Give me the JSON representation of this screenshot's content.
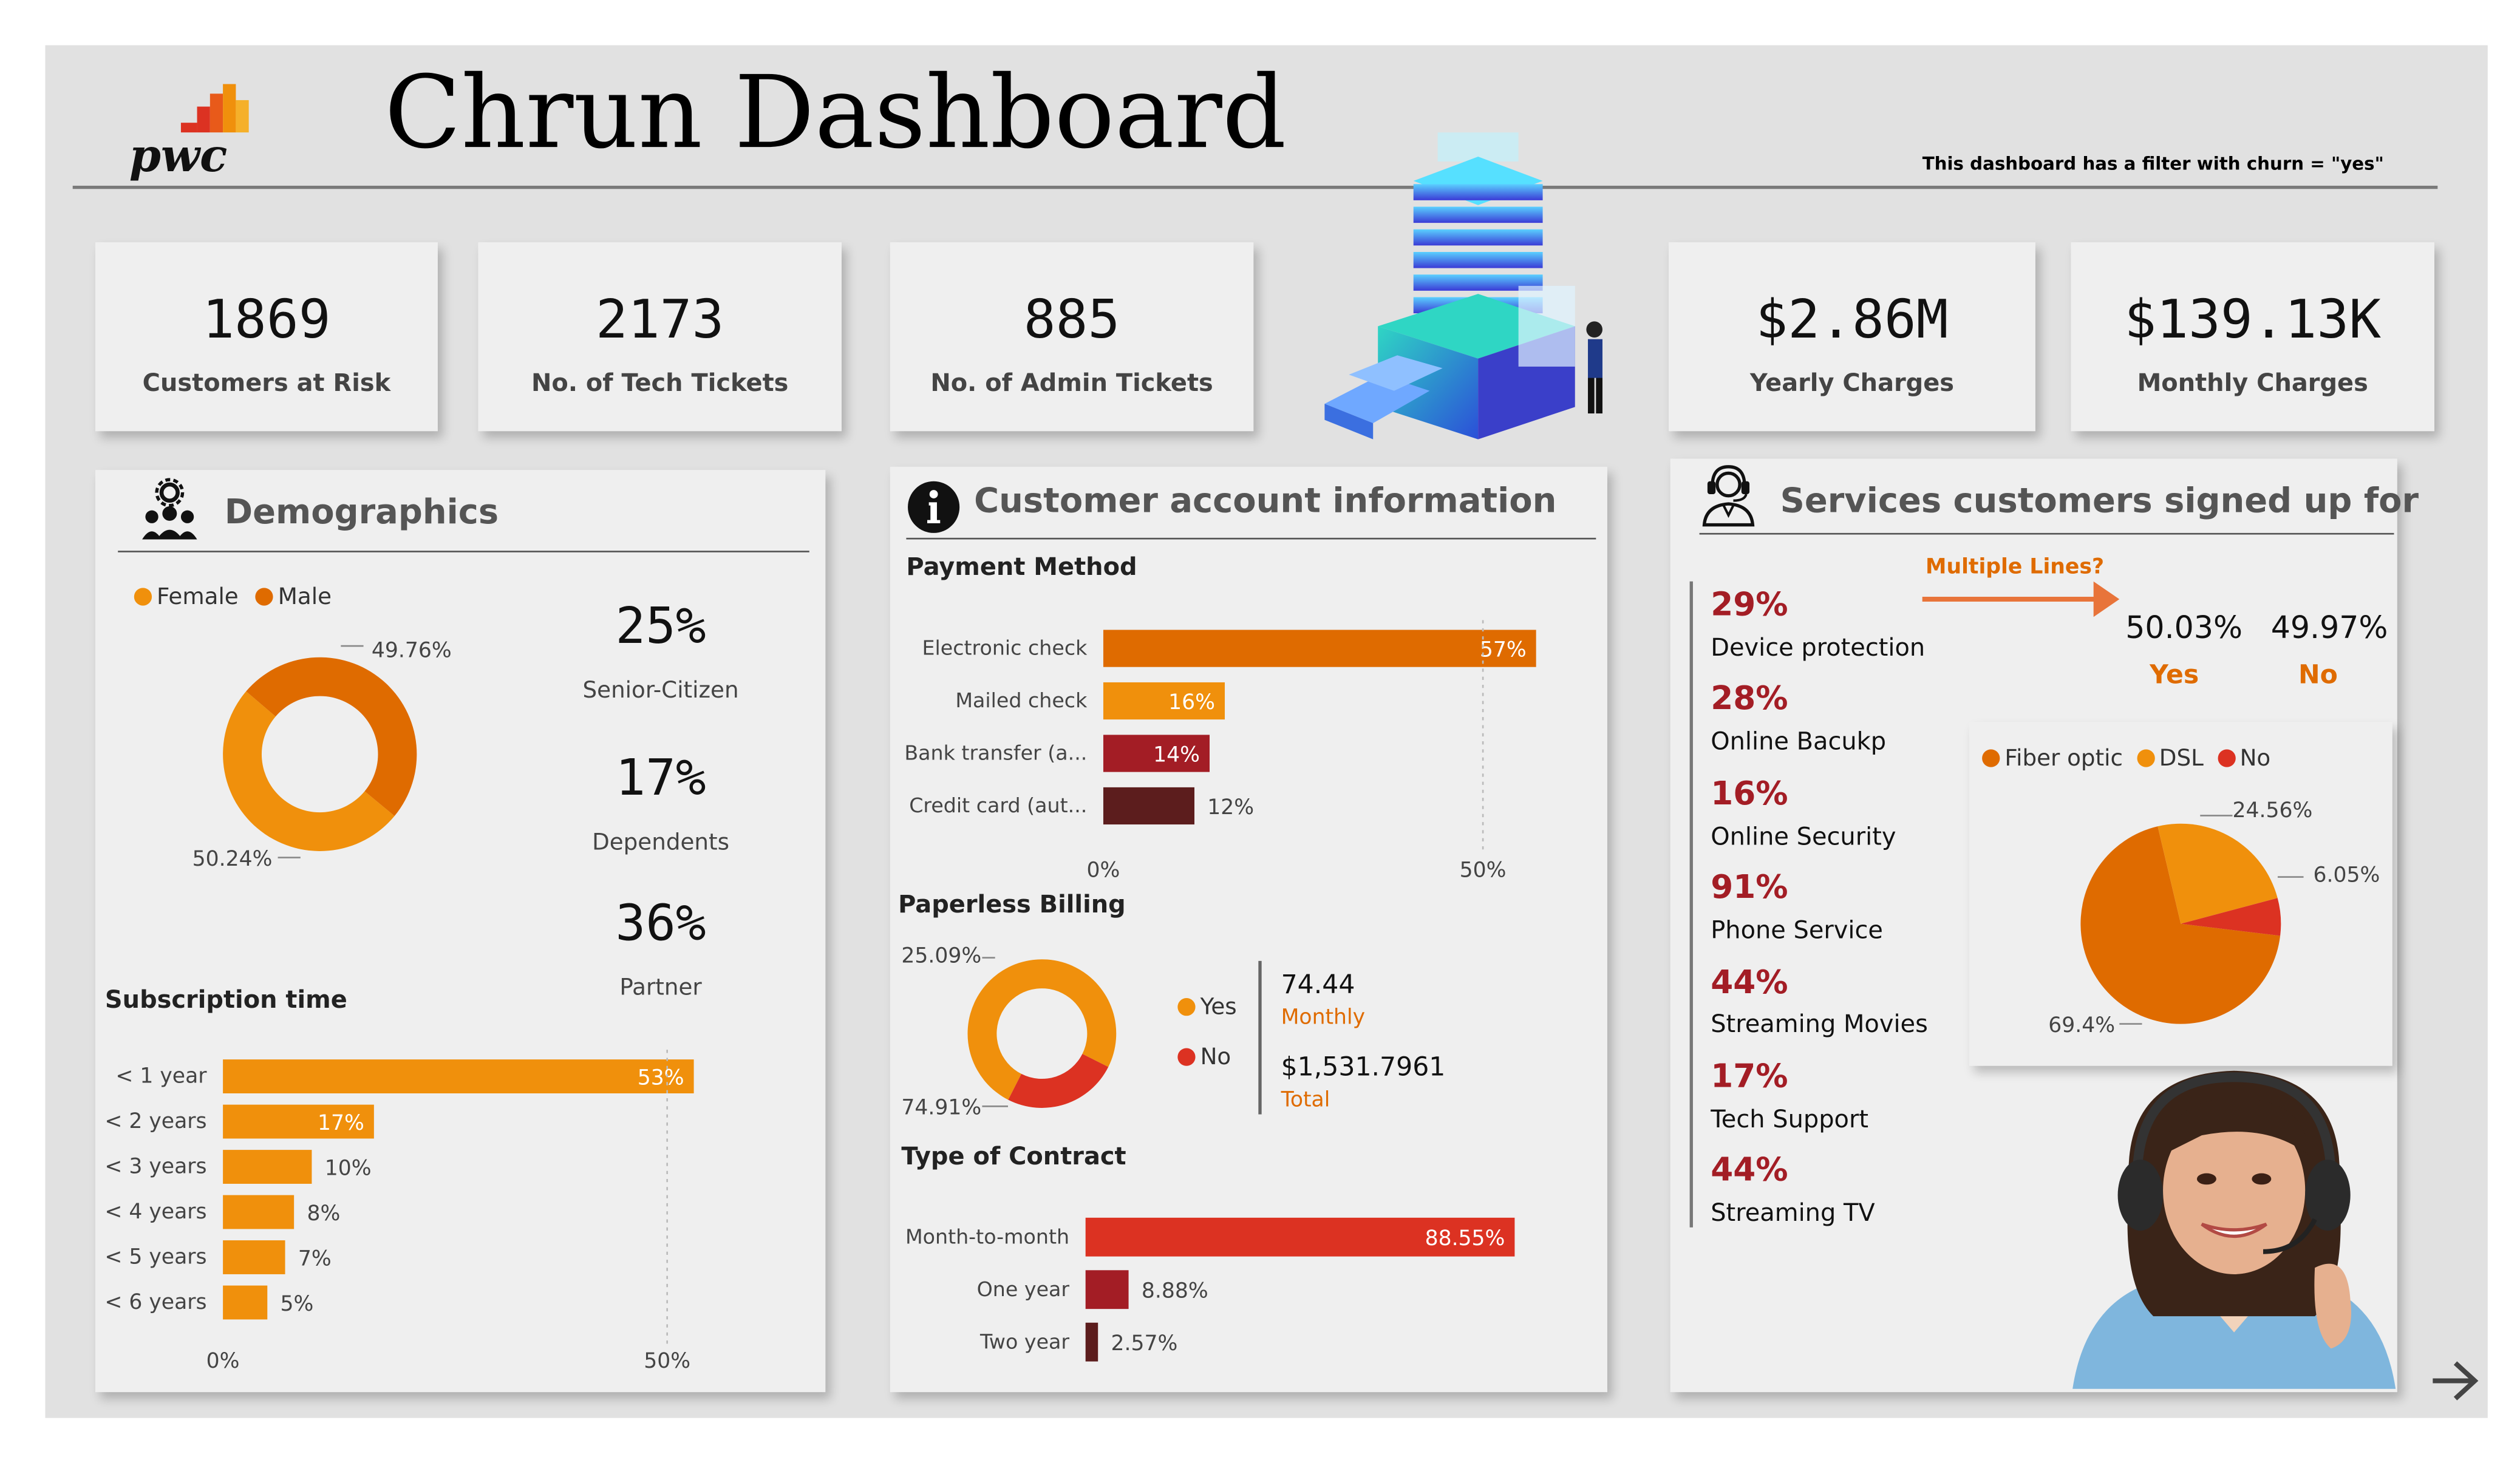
{
  "header": {
    "title": "Chrun Dashboard",
    "logo_text": "pwc",
    "filter_note": "This dashboard has a filter with churn = \"yes\""
  },
  "kpis": [
    {
      "value": "1869",
      "label": "Customers at Risk"
    },
    {
      "value": "2173",
      "label": "No. of Tech Tickets"
    },
    {
      "value": "885",
      "label": "No. of Admin Tickets"
    },
    {
      "value": "$2.86M",
      "label": "Yearly Charges"
    },
    {
      "value": "$139.13K",
      "label": "Monthly Charges"
    }
  ],
  "demographics": {
    "title": "Demographics",
    "stats": [
      {
        "value": "25%",
        "label": "Senior-Citizen"
      },
      {
        "value": "17%",
        "label": "Dependents"
      },
      {
        "value": "36%",
        "label": "Partner"
      }
    ]
  },
  "account": {
    "title": "Customer account information",
    "total_value": "74.44",
    "total_label": "Monthly",
    "grand_value": "$1,531.7961",
    "grand_label": "Total"
  },
  "services": {
    "title": "Services customers signed up for",
    "multiple_lines_label": "Multiple Lines?",
    "multiple_lines": [
      {
        "value": "50.03%",
        "label": "Yes"
      },
      {
        "value": "49.97%",
        "label": "No"
      }
    ],
    "items": [
      {
        "pct": "29%",
        "label": "Device protection"
      },
      {
        "pct": "28%",
        "label": "Online Bacukp"
      },
      {
        "pct": "16%",
        "label": "Online Security"
      },
      {
        "pct": "91%",
        "label": "Phone Service"
      },
      {
        "pct": "44%",
        "label": "Streaming Movies"
      },
      {
        "pct": "17%",
        "label": "Tech Support"
      },
      {
        "pct": "44%",
        "label": "Streaming TV"
      }
    ]
  },
  "colors": {
    "orange": "#f0900c",
    "dark_orange": "#df6b00",
    "red": "#dc3222",
    "dark_red": "#a31d25",
    "maroon": "#5c1d1d",
    "panel": "#efefef",
    "background": "#e1e1e1"
  },
  "icons": [
    "demographics-people-icon",
    "info-icon",
    "headset-agent-icon",
    "building-illustration",
    "support-agent-photo",
    "next-arrow-icon"
  ],
  "chart_data": [
    {
      "id": "gender",
      "type": "pie",
      "title": "",
      "legend": [
        "Female",
        "Male"
      ],
      "values": [
        50.24,
        49.76
      ],
      "labels": [
        "50.24%",
        "49.76%"
      ],
      "colors": [
        "#f0900c",
        "#df6b00"
      ],
      "donut": true
    },
    {
      "id": "subscription",
      "type": "bar",
      "title": "Subscription time",
      "orientation": "horizontal",
      "categories": [
        "< 1 year",
        "< 2 years",
        "< 3 years",
        "< 4 years",
        "< 5 years",
        "< 6 years"
      ],
      "values": [
        53,
        17,
        10,
        8,
        7,
        5
      ],
      "value_labels": [
        "53%",
        "17%",
        "10%",
        "8%",
        "7%",
        "5%"
      ],
      "colors": [
        "#f0900c"
      ],
      "xticks": [
        "0%",
        "50%"
      ],
      "xlim": [
        0,
        60
      ]
    },
    {
      "id": "payment",
      "type": "bar",
      "title": "Payment Method",
      "orientation": "horizontal",
      "categories": [
        "Electronic check",
        "Mailed check",
        "Bank transfer (a...",
        "Credit card (aut..."
      ],
      "values": [
        57,
        16,
        14,
        12
      ],
      "value_labels": [
        "57%",
        "16%",
        "14%",
        "12%"
      ],
      "colors": [
        "#df6b00",
        "#f0900c",
        "#a31d25",
        "#5c1d1d"
      ],
      "xticks": [
        "0%",
        "50%"
      ],
      "xlim": [
        0,
        60
      ]
    },
    {
      "id": "paperless",
      "type": "pie",
      "title": "Paperless Billing",
      "legend": [
        "Yes",
        "No"
      ],
      "values": [
        74.91,
        25.09
      ],
      "labels": [
        "74.91%",
        "25.09%"
      ],
      "colors": [
        "#f0900c",
        "#dc3222"
      ],
      "donut": true
    },
    {
      "id": "contract",
      "type": "bar",
      "title": "Type of Contract",
      "orientation": "horizontal",
      "categories": [
        "Month-to-month",
        "One year",
        "Two year"
      ],
      "values": [
        88.55,
        8.88,
        2.57
      ],
      "value_labels": [
        "88.55%",
        "8.88%",
        "2.57%"
      ],
      "colors": [
        "#dc3222",
        "#a31d25",
        "#5c1d1d"
      ],
      "xlim": [
        0,
        100
      ]
    },
    {
      "id": "internet",
      "type": "pie",
      "title": "",
      "legend": [
        "Fiber optic",
        "DSL",
        "No"
      ],
      "values": [
        69.4,
        24.56,
        6.05
      ],
      "labels": [
        "69.4%",
        "24.56%",
        "6.05%"
      ],
      "colors": [
        "#df6b00",
        "#f0900c",
        "#dc3222"
      ],
      "donut": false
    }
  ]
}
